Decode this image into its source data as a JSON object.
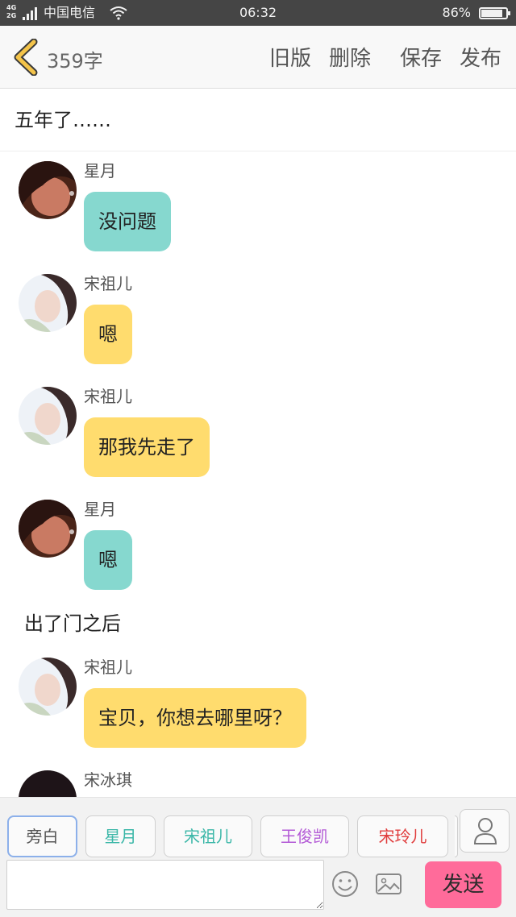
{
  "status_bar": {
    "network": "4G",
    "network2": "2G",
    "carrier": "中国电信",
    "time": "06:32",
    "battery_percent": "86%",
    "battery_level": 0.86
  },
  "toolbar": {
    "char_count": "359字",
    "old_version": "旧版",
    "delete": "删除",
    "save": "保存",
    "publish": "发布"
  },
  "chat_title": "五年了……",
  "messages": [
    {
      "sender": "星月",
      "text": "没问题",
      "bubble_color": "#86d8cf",
      "avatar": "xingyue"
    },
    {
      "sender": "宋祖儿",
      "text": "嗯",
      "bubble_color": "#ffdc6e",
      "avatar": "songzuer"
    },
    {
      "sender": "宋祖儿",
      "text": "那我先走了",
      "bubble_color": "#ffdc6e",
      "avatar": "songzuer"
    },
    {
      "sender": "星月",
      "text": "嗯",
      "bubble_color": "#86d8cf",
      "avatar": "xingyue"
    },
    {
      "narration": "出了门之后"
    },
    {
      "sender": "宋祖儿",
      "text": "宝贝，你想去哪里呀？",
      "bubble_color": "#ffdc6e",
      "avatar": "songzuer"
    },
    {
      "sender": "宋冰琪",
      "avatar": "songbingqi"
    }
  ],
  "characters": [
    {
      "name": "旁白",
      "color": "#555555",
      "selected": true
    },
    {
      "name": "星月",
      "color": "#3bb7a8"
    },
    {
      "name": "宋祖儿",
      "color": "#3bb7a8"
    },
    {
      "name": "王俊凯",
      "color": "#b35ad6"
    },
    {
      "name": "宋玲儿",
      "color": "#e03c3c"
    }
  ],
  "input": {
    "value": "",
    "placeholder": "",
    "send_label": "发送"
  },
  "colors": {
    "accent_send": "#ff6b9a",
    "back_arrow": "#f4c44a",
    "bubble_teal": "#86d8cf",
    "bubble_yellow": "#ffdc6e"
  }
}
